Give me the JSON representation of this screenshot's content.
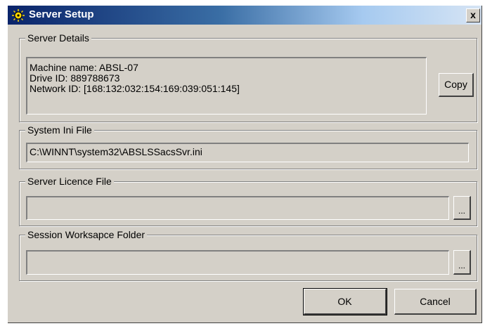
{
  "window": {
    "title": "Server Setup",
    "close_label": "x"
  },
  "server_details": {
    "legend": "Server Details",
    "lines": [
      "Machine name: ABSL-07",
      "Drive ID: 889788673",
      "Network ID: [168:132:032:154:169:039:051:145]"
    ],
    "copy_label": "Copy"
  },
  "system_ini": {
    "legend": "System Ini File",
    "value": "C:\\WINNT\\system32\\ABSLSSacsSvr.ini"
  },
  "licence_file": {
    "legend": "Server Licence File",
    "value": "",
    "browse_label": "..."
  },
  "workspace_folder": {
    "legend": "Session Worksapce Folder",
    "value": "",
    "browse_label": "..."
  },
  "buttons": {
    "ok_label": "OK",
    "cancel_label": "Cancel"
  },
  "icons": {
    "app_icon": "sun-icon",
    "close_icon": "close-icon",
    "browse_icon": "ellipsis"
  },
  "colors": {
    "face": "#d4d0c8",
    "titlebar_start": "#0a246a",
    "titlebar_end": "#d6e4f4"
  }
}
